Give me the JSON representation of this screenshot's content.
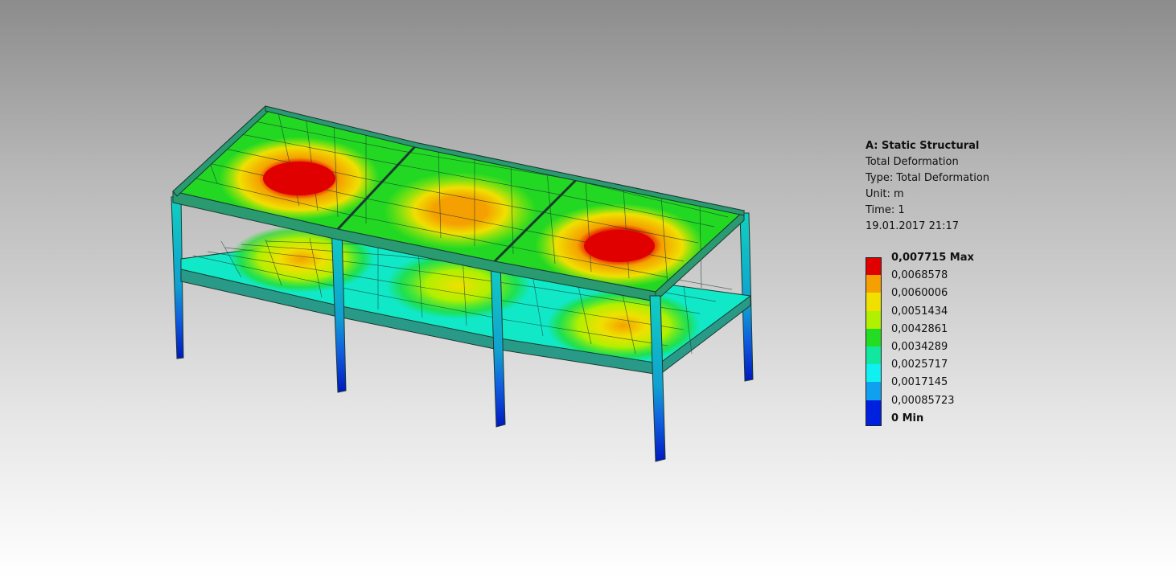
{
  "info": {
    "title": "A: Static Structural",
    "lines": [
      "Total Deformation",
      "Type: Total Deformation",
      "Unit: m",
      "Time: 1",
      "19.01.2017 21:17"
    ]
  },
  "legend": {
    "entries": [
      {
        "label": "0,007715 Max",
        "color": "#e00000",
        "bold": true
      },
      {
        "label": "0,0068578",
        "color": "#f5a000",
        "bold": false
      },
      {
        "label": "0,0060006",
        "color": "#f0e000",
        "bold": false
      },
      {
        "label": "0,0051434",
        "color": "#b0f000",
        "bold": false
      },
      {
        "label": "0,0042861",
        "color": "#22dd22",
        "bold": false
      },
      {
        "label": "0,0034289",
        "color": "#10e8a0",
        "bold": false
      },
      {
        "label": "0,0025717",
        "color": "#10f0f0",
        "bold": false
      },
      {
        "label": "0,0017145",
        "color": "#10a0f0",
        "bold": false
      },
      {
        "label": "0,00085723",
        "color": "#0020e0",
        "bold": false
      },
      {
        "label": "0 Min",
        "color": "#0020e0",
        "bold": true
      }
    ]
  },
  "model": {
    "colors": {
      "max": "#e00000",
      "orange": "#f5a000",
      "yellow": "#f0e000",
      "yellowgreen": "#b0f000",
      "green": "#22dd22",
      "teal": "#10e8a0",
      "cyan": "#10f0f0",
      "sky": "#10a0f0",
      "min": "#0020e0",
      "beam": "#2a8a70",
      "edge": "#1a3a30"
    }
  }
}
